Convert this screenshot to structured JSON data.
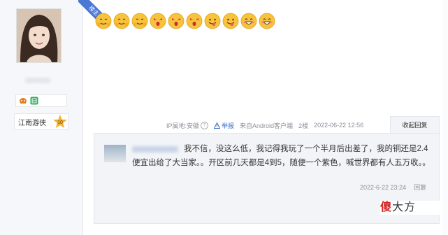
{
  "ribbon": {
    "label": "楼主"
  },
  "author": {
    "level_title": "江南游侠",
    "level_number": "10"
  },
  "emojis": [
    "hug-emoji",
    "hug-emoji",
    "hug-emoji",
    "kiss-emoji",
    "kiss-emoji",
    "kiss-emoji",
    "tongue-emoji",
    "tongue-emoji",
    "grin-emoji",
    "grin-emoji"
  ],
  "meta": {
    "ip_location": "IP属地:安徽",
    "report": "举报",
    "source": "来自Android客户端",
    "floor": "2楼",
    "timestamp": "2022-06-22 12:56",
    "reply_toggle": "收起回复"
  },
  "reply": {
    "text": "我不信，没这么低，我记得我玩了一个半月后出差了，我的铜还是2.4便宜出给了大当家。。开区前几天都是4到5，随便一个紫色，喊世界都有人五万收。。",
    "time": "2022-6-22 23:24",
    "reply_label": "回复"
  },
  "watermark": {
    "accent": "傻",
    "rest": "大方"
  },
  "colors": {
    "accent_blue": "#3a6ec8",
    "ribbon_blue": "#4a78d6",
    "reply_bg": "#f2f4f8"
  }
}
